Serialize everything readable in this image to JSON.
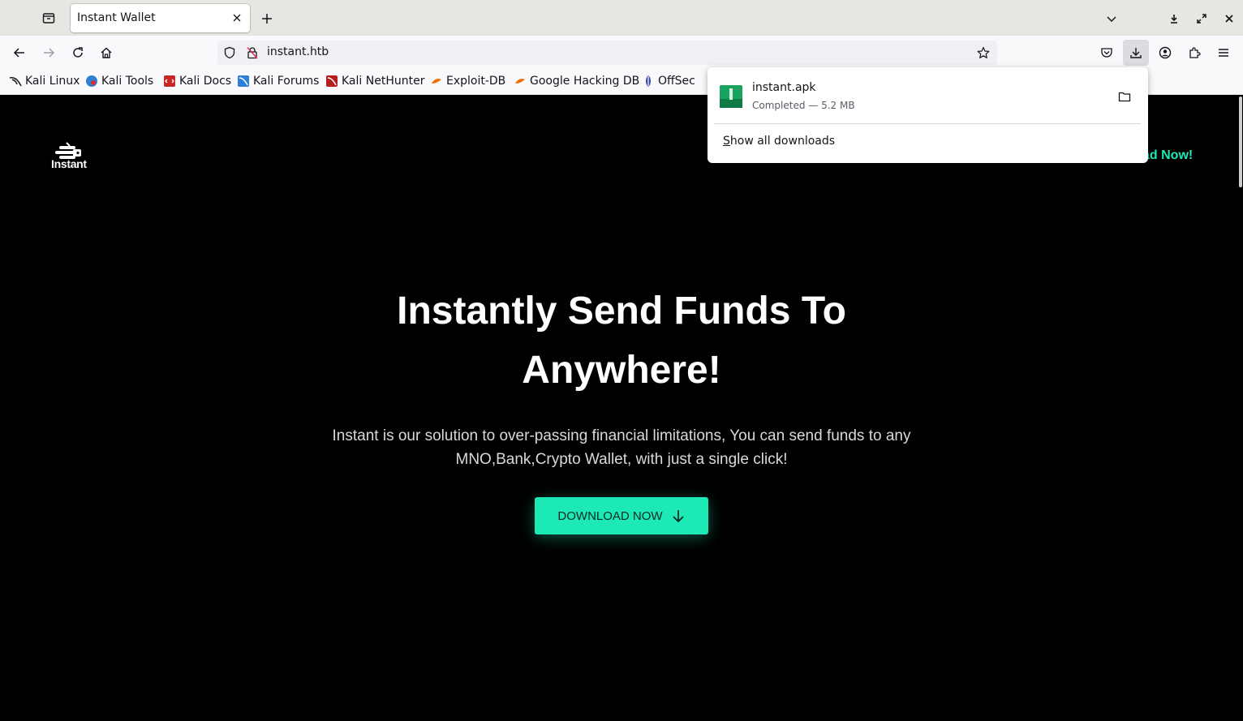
{
  "browser": {
    "tab": {
      "title": "Instant Wallet"
    },
    "url": "instant.htb",
    "bookmarks": [
      {
        "label": "Kali Linux",
        "icon": "kali-dragon-icon"
      },
      {
        "label": "Kali Tools",
        "icon": "kali-tools-icon"
      },
      {
        "label": "Kali Docs",
        "icon": "kali-docs-icon"
      },
      {
        "label": "Kali Forums",
        "icon": "kali-forums-icon"
      },
      {
        "label": "Kali NetHunter",
        "icon": "kali-nethunter-icon"
      },
      {
        "label": "Exploit-DB",
        "icon": "exploit-db-icon"
      },
      {
        "label": "Google Hacking DB",
        "icon": "ghdb-icon"
      },
      {
        "label": "OffSec",
        "icon": "offsec-icon"
      }
    ]
  },
  "downloads_panel": {
    "file_name": "instant.apk",
    "status": "Completed — 5.2 MB",
    "show_all_prefix": "S",
    "show_all_rest": "how all downloads"
  },
  "page": {
    "logo_text": "Instant",
    "nav_link_partial": "ad Now!",
    "hero_title": "Instantly Send Funds To Anywhere!",
    "hero_subtitle": "Instant is our solution to over-passing financial limitations, You can send funds to any MNO,Bank,Crypto Wallet, with just a single click!",
    "cta_label": "DOWNLOAD NOW"
  },
  "colors": {
    "accent": "#1de9b6",
    "page_background": "#000000",
    "apk_icon": "#1aa260"
  }
}
